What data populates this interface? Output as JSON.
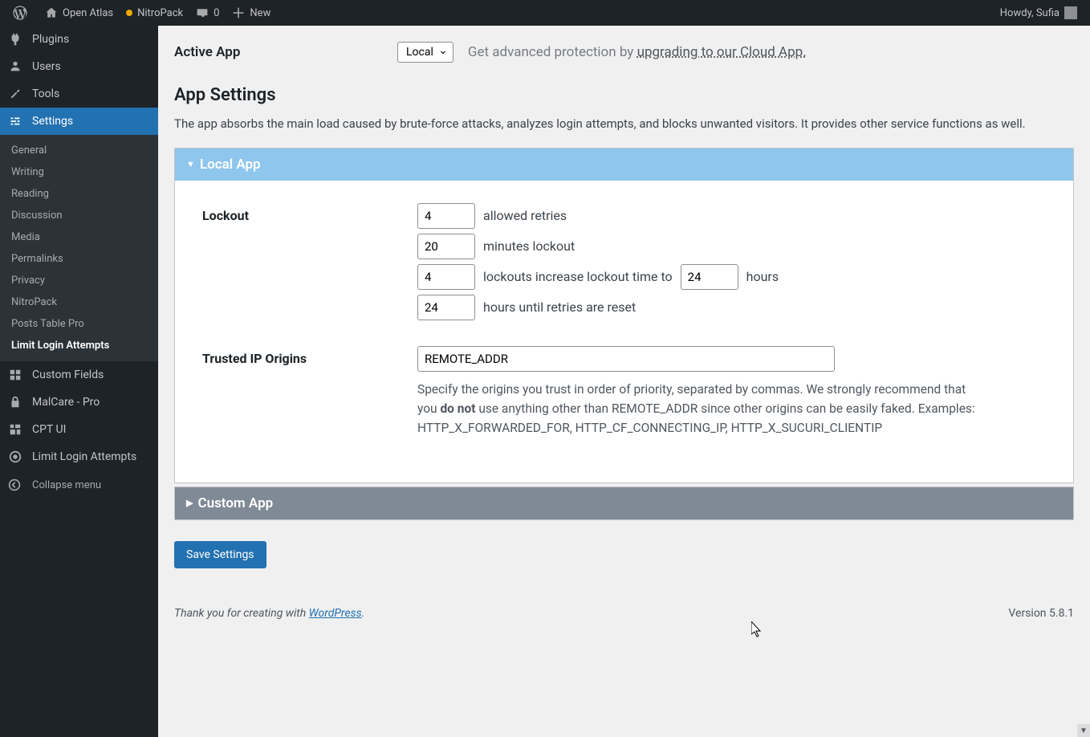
{
  "adminbar": {
    "site_name": "Open Atlas",
    "nitropack": "NitroPack",
    "comments_count": "0",
    "new": "New",
    "howdy": "Howdy, Sufia"
  },
  "sidebar": {
    "items": [
      {
        "label": "Plugins"
      },
      {
        "label": "Users"
      },
      {
        "label": "Tools"
      },
      {
        "label": "Settings"
      },
      {
        "label": "Custom Fields"
      },
      {
        "label": "MalCare - Pro"
      },
      {
        "label": "CPT UI"
      },
      {
        "label": "Limit Login Attempts"
      }
    ],
    "submenu": [
      "General",
      "Writing",
      "Reading",
      "Discussion",
      "Media",
      "Permalinks",
      "Privacy",
      "NitroPack",
      "Posts Table Pro",
      "Limit Login Attempts"
    ],
    "collapse": "Collapse menu"
  },
  "page": {
    "active_app_label": "Active App",
    "active_app_value": "Local",
    "upgrade_prefix": "Get advanced protection by ",
    "upgrade_link": "upgrading to our Cloud App.",
    "section_title": "App Settings",
    "description": "The app absorbs the main load caused by brute-force attacks, analyzes login attempts, and blocks unwanted visitors. It provides other service functions as well.",
    "panel_local": "Local App",
    "panel_custom": "Custom App",
    "lockout": {
      "label": "Lockout",
      "allowed_retries": "4",
      "allowed_retries_text": "allowed retries",
      "minutes_lockout": "20",
      "minutes_lockout_text": "minutes lockout",
      "lockouts_increase": "4",
      "lockouts_increase_text": "lockouts increase lockout time to",
      "hours_val": "24",
      "hours_text": "hours",
      "until_reset": "24",
      "until_reset_text": "hours until retries are reset"
    },
    "trusted": {
      "label": "Trusted IP Origins",
      "value": "REMOTE_ADDR",
      "help_pre": "Specify the origins you trust in order of priority, separated by commas. We strongly recommend that you ",
      "help_bold": "do not",
      "help_post": " use anything other than REMOTE_ADDR since other origins can be easily faked. Examples: HTTP_X_FORWARDED_FOR, HTTP_CF_CONNECTING_IP, HTTP_X_SUCURI_CLIENTIP"
    },
    "save": "Save Settings"
  },
  "footer": {
    "thank_pre": "Thank you for creating with ",
    "wp": "WordPress",
    "version": "Version 5.8.1"
  }
}
